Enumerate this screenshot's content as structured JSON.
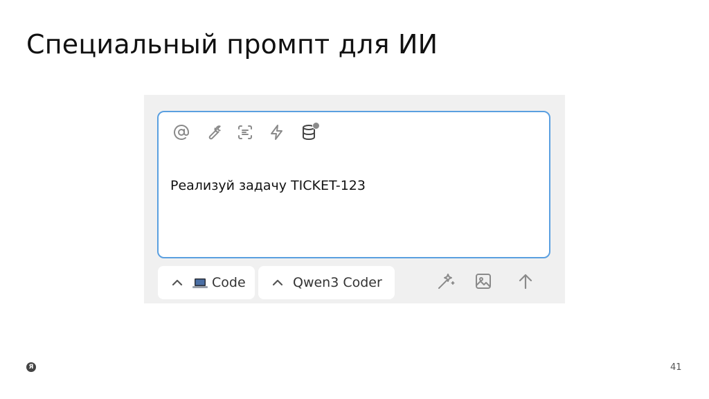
{
  "slide": {
    "title": "Специальный промпт для ИИ",
    "page_number": "41",
    "logo_letter": "Я"
  },
  "toolbar": {
    "icons": [
      "at-icon",
      "wrench-icon",
      "scan-text-icon",
      "lightning-icon",
      "database-icon"
    ]
  },
  "composer": {
    "text": "Реализуй задачу TICKET-123"
  },
  "mode_selector": {
    "label": "Code"
  },
  "model_selector": {
    "label": "Qwen3 Coder"
  },
  "actions": {
    "icons": [
      "magic-wand-icon",
      "image-icon",
      "send-arrow-icon"
    ]
  },
  "colors": {
    "focus_border": "#5a9fe0",
    "panel_bg": "#f0f0f0",
    "icon_gray": "#8a8a8a"
  }
}
